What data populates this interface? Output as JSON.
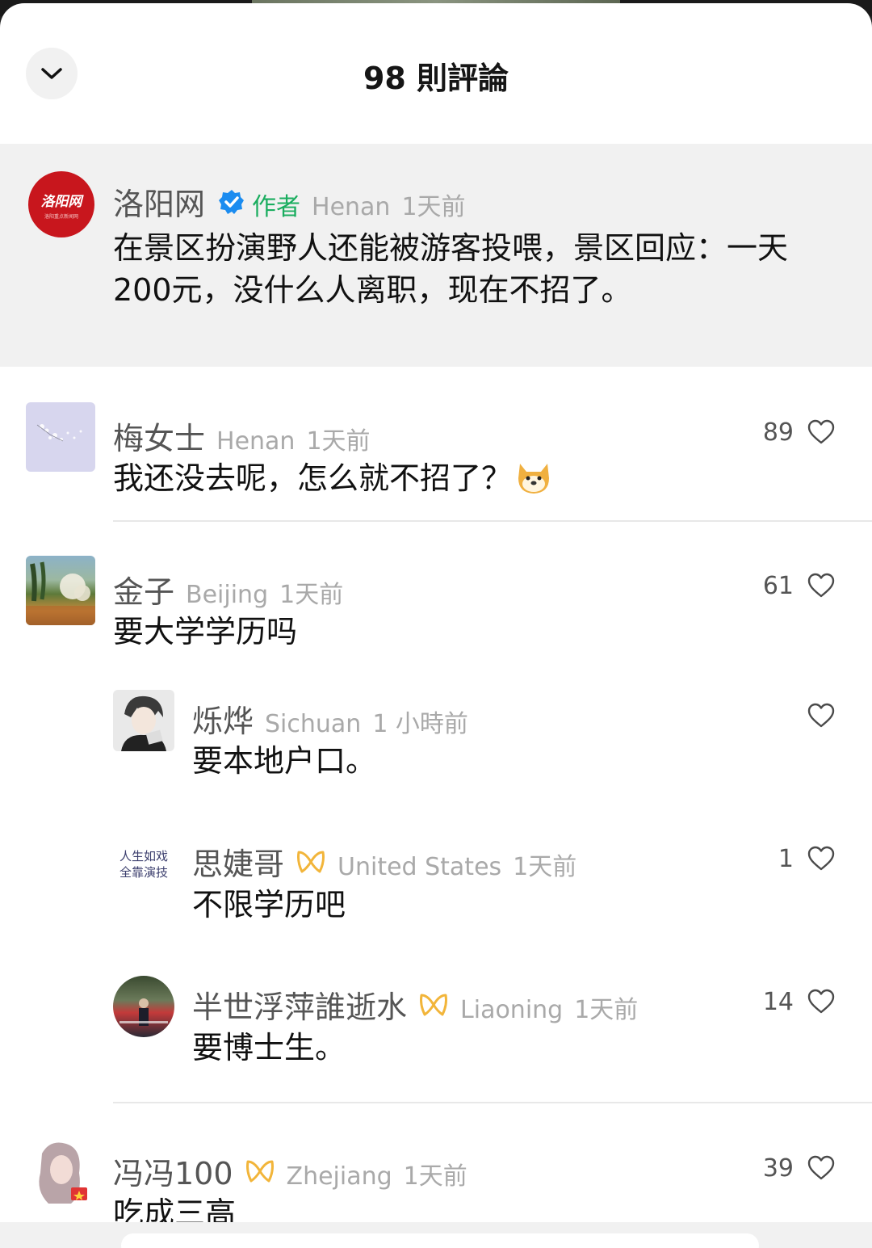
{
  "header": {
    "title": "98 則評論",
    "collapse_icon": "chevron-down-icon"
  },
  "pinned": {
    "avatar_text": "洛阳网",
    "avatar_subtext": "洛阳重点新闻网",
    "user": "洛阳网",
    "author_tag": "作者",
    "location": "Henan",
    "time": "1天前",
    "text_line1": "在景区扮演野人还能被游客投喂，景区回应：一天",
    "text_line2": "200元，没什么人离职，现在不招了。"
  },
  "comments": [
    {
      "user": "梅女士",
      "location": "Henan",
      "time": "1天前",
      "text": "我还没去呢，怎么就不招了？",
      "likes": "89"
    },
    {
      "user": "金子",
      "location": "Beijing",
      "time": "1天前",
      "text": "要大学学历吗",
      "likes": "61"
    },
    {
      "user": "烁烨",
      "location": "Sichuan",
      "time": "1 小時前",
      "text": "要本地户口。",
      "likes": ""
    },
    {
      "user": "思婕哥",
      "location": "United States",
      "time": "1天前",
      "text": "不限学历吧",
      "likes": "1",
      "avatar_line1": "人生如戏",
      "avatar_line2": "全靠演技"
    },
    {
      "user": "半世浮萍誰逝水",
      "location": "Liaoning",
      "time": "1天前",
      "text": "要博士生。",
      "likes": "14"
    },
    {
      "user": "冯冯100",
      "location": "Zhejiang",
      "time": "1天前",
      "text": "吃成三高",
      "likes": "39"
    }
  ],
  "colors": {
    "author_green": "#1aad5f",
    "verified_blue": "#1b8cf0",
    "badge_gold": "#f2b53a"
  }
}
